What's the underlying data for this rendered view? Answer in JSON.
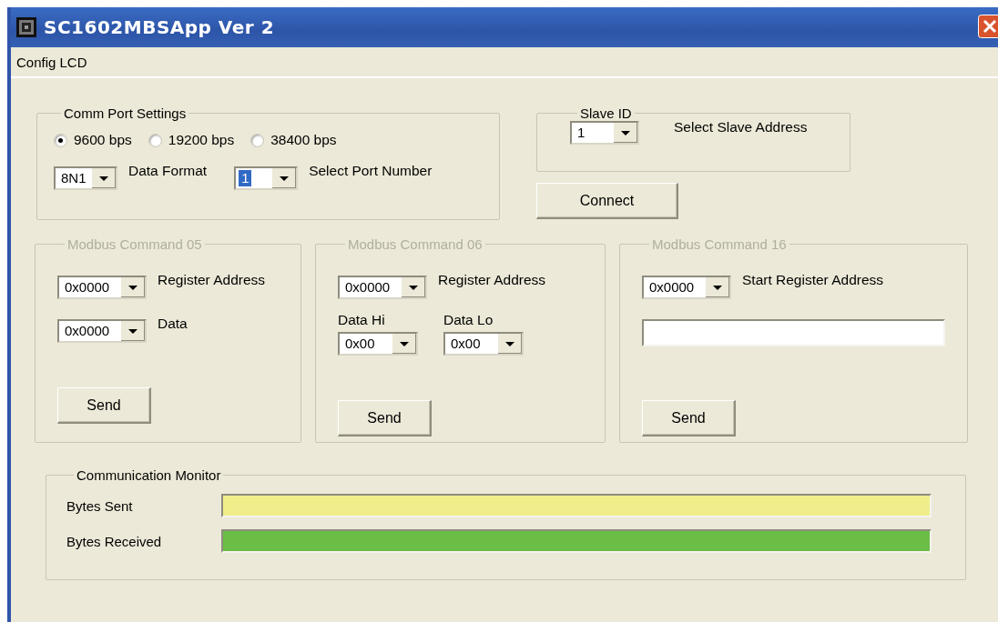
{
  "window": {
    "title": "SC1602MBSApp Ver 2"
  },
  "menu": [
    "Config LCD"
  ],
  "comm_port_settings": {
    "title": "Comm Port Settings",
    "disabled": false,
    "baud_rates": [
      {
        "label": "9600 bps",
        "selected": true
      },
      {
        "label": "19200 bps",
        "selected": false
      },
      {
        "label": "38400 bps",
        "selected": false
      }
    ],
    "data_format": {
      "value": "8N1",
      "label": "Data Format",
      "text_selected": false
    },
    "port_number": {
      "value": "1",
      "label": "Select Port Number",
      "text_selected": true
    }
  },
  "slave_id": {
    "title": "Slave ID",
    "disabled": false,
    "value": "1",
    "label": "Select Slave Address"
  },
  "connect_button": "Connect",
  "modbus_commands": [
    {
      "title": "Modbus Command 05",
      "disabled": true,
      "items": [
        {
          "kind": "combo",
          "value": "0x0000",
          "label": "Register Address"
        },
        {
          "kind": "combo",
          "value": "0x0000",
          "label": "Data"
        }
      ],
      "button": "Send"
    },
    {
      "title": "Modbus Command 06",
      "disabled": true,
      "items": [
        {
          "kind": "combo",
          "value": "0x0000",
          "label": "Register Address"
        },
        {
          "kind": "pair",
          "fields": [
            {
              "label": "Data Hi",
              "value": "0x00"
            },
            {
              "label": "Data Lo",
              "value": "0x00"
            }
          ]
        }
      ],
      "button": "Send"
    },
    {
      "title": "Modbus Command 16",
      "disabled": true,
      "items": [
        {
          "kind": "combo",
          "value": "0x0000",
          "label": "Start Register Address"
        },
        {
          "kind": "textbox"
        }
      ],
      "button": "Send"
    }
  ],
  "communication_monitor": {
    "title": "Communication Monitor",
    "rows": [
      {
        "label": "Bytes Sent",
        "color": "#f0ee8a"
      },
      {
        "label": "Bytes Received",
        "color": "#6abd45"
      }
    ]
  }
}
